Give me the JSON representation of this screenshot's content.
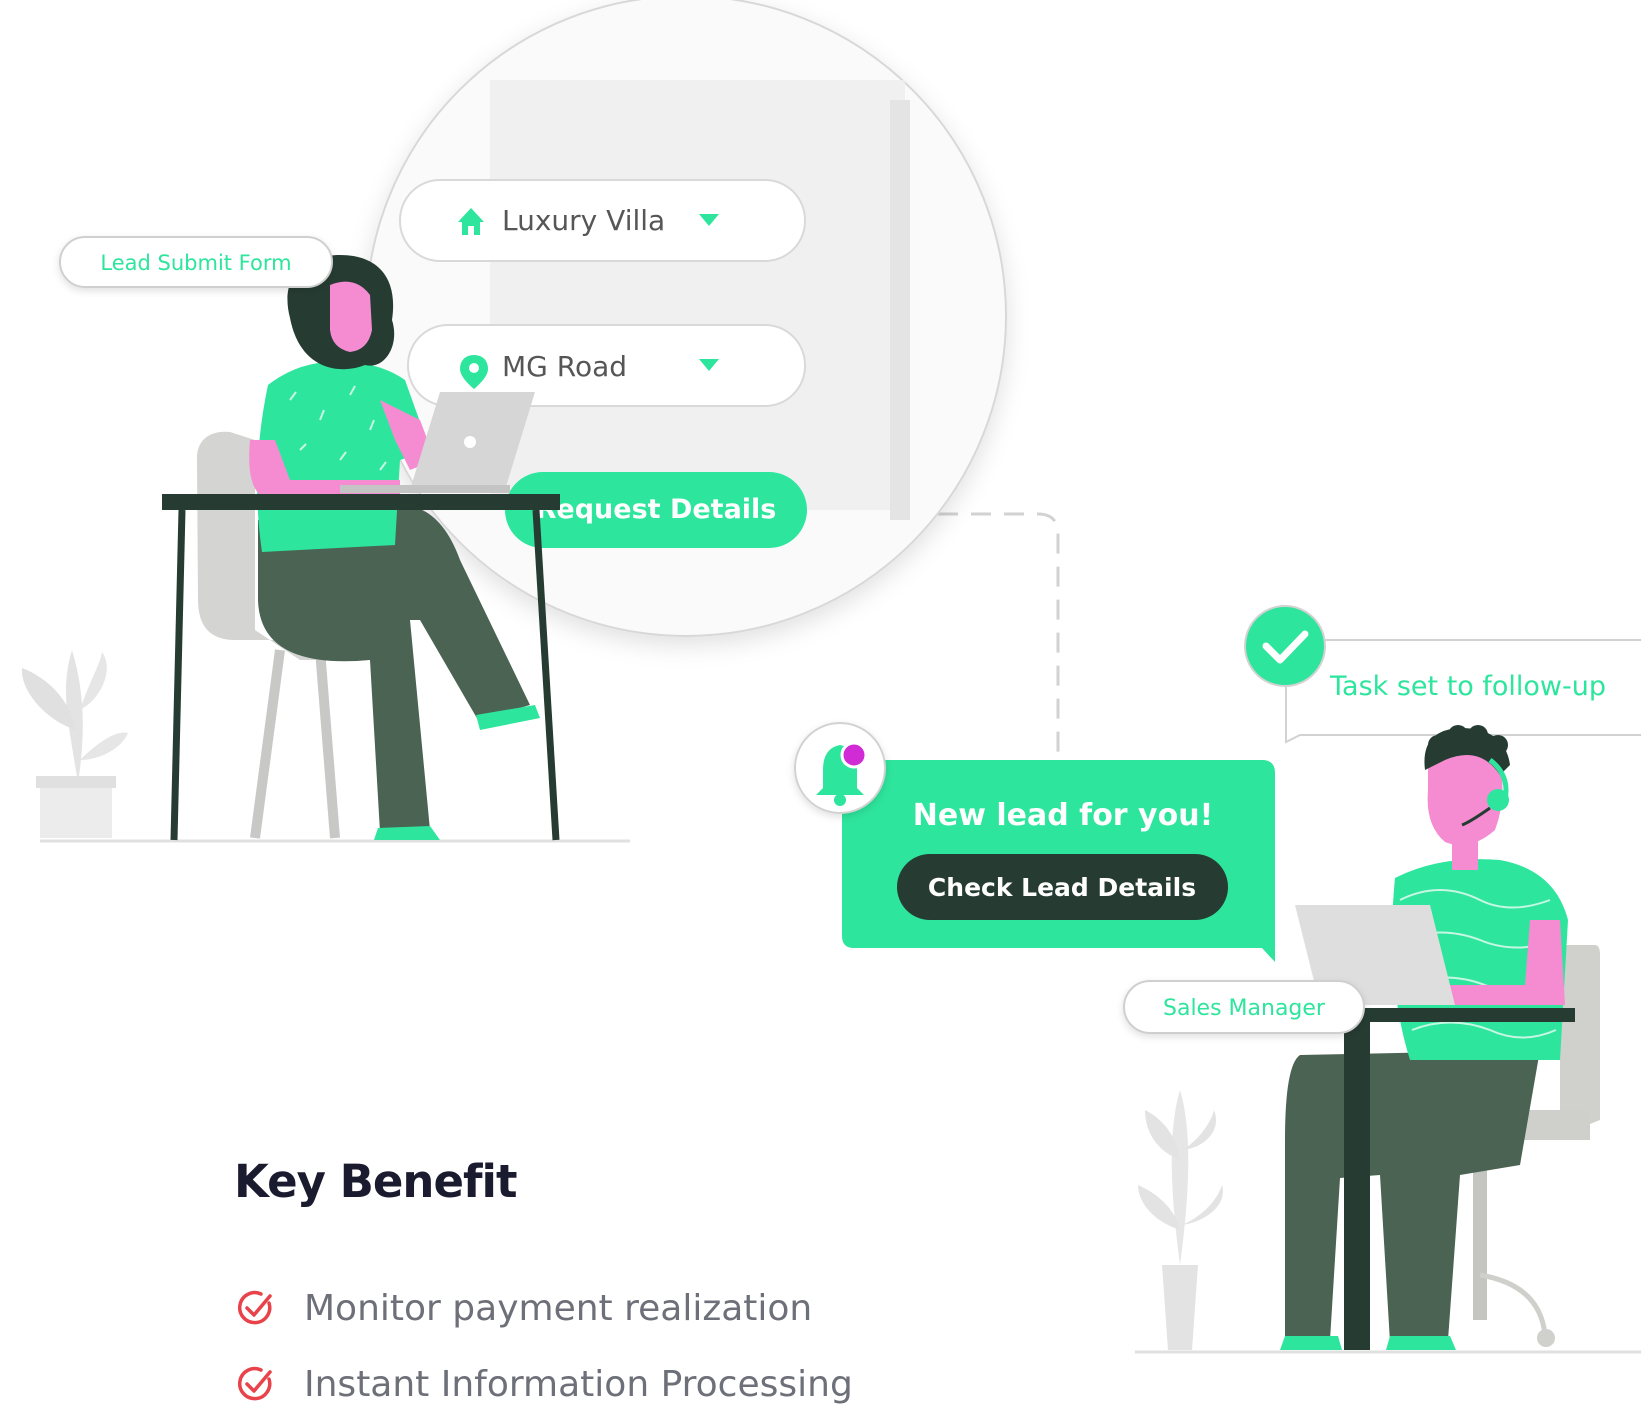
{
  "illustration": {
    "lead_form_label": "Lead Submit Form",
    "property_type_value": "Luxury Villa",
    "location_value": "MG Road",
    "request_button_label": "Request Details",
    "notification_text": "New lead for you!",
    "check_lead_button_label": "Check Lead Details",
    "task_status_text": "Task set to follow-up",
    "sales_manager_label": "Sales Manager",
    "icons": [
      "home-icon",
      "location-pin-icon",
      "dropdown-caret-icon",
      "bell-icon",
      "check-icon"
    ]
  },
  "colors": {
    "accent": "#2ee59d",
    "dark": "#263c33",
    "skin": "#f58bd1",
    "notification_dot": "#d12bd6",
    "check_red": "#e8434a"
  },
  "benefits": {
    "title": "Key Benefit",
    "items": [
      "Monitor payment realization",
      "Instant Information Processing"
    ]
  }
}
